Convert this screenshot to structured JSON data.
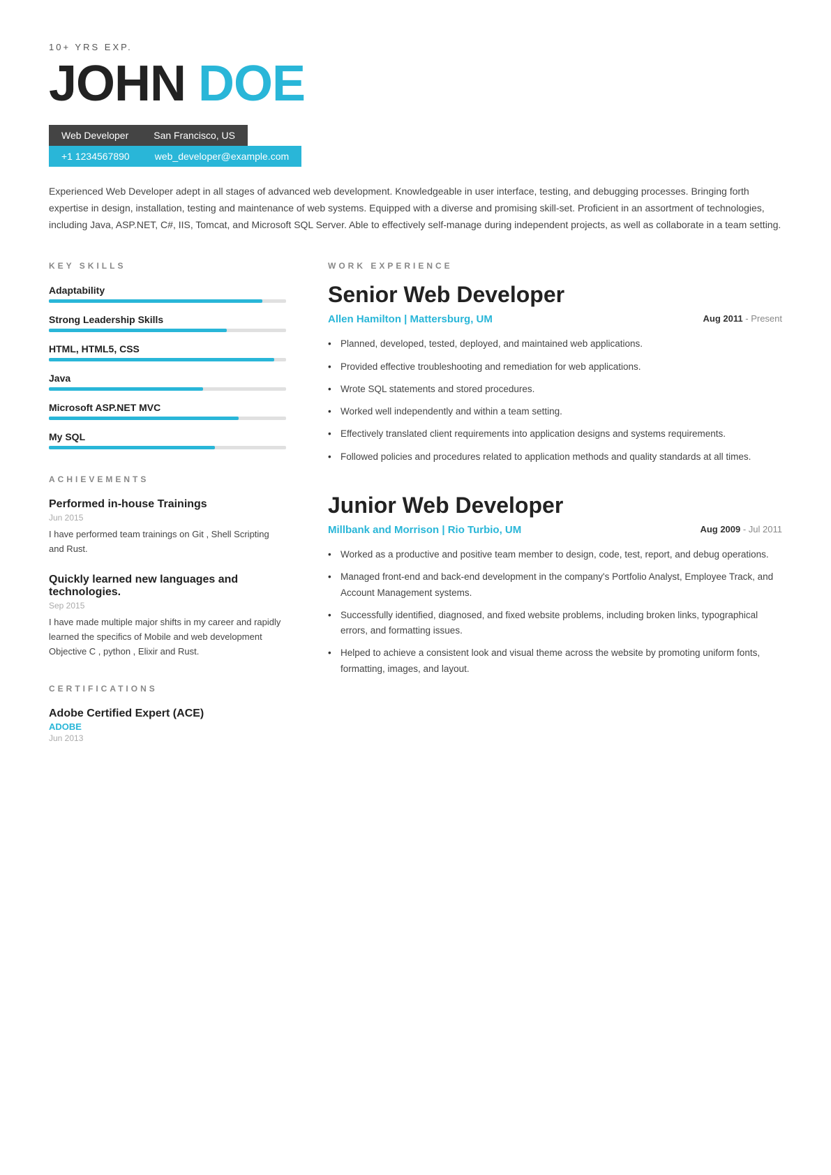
{
  "header": {
    "exp_label": "10+ YRS EXP.",
    "first_name": "JOHN",
    "last_name": "DOE",
    "title": "Web Developer",
    "location": "San Francisco, US",
    "phone": "+1 1234567890",
    "email": "web_developer@example.com"
  },
  "summary": "Experienced Web Developer adept in all stages of advanced web development. Knowledgeable in user interface, testing, and debugging processes. Bringing forth expertise in design, installation, testing and maintenance of web systems. Equipped with a diverse and promising skill-set. Proficient in an assortment of technologies, including Java, ASP.NET, C#, IIS, Tomcat, and Microsoft SQL Server. Able to effectively self-manage during independent projects, as well as collaborate in a team setting.",
  "sections": {
    "key_skills_label": "KEY SKILLS",
    "work_experience_label": "WORK EXPERIENCE",
    "achievements_label": "ACHIEVEMENTS",
    "certifications_label": "CERTIFICATIONS"
  },
  "skills": [
    {
      "name": "Adaptability",
      "pct": 90
    },
    {
      "name": "Strong Leadership Skills",
      "pct": 75
    },
    {
      "name": "HTML, HTML5, CSS",
      "pct": 95
    },
    {
      "name": "Java",
      "pct": 65
    },
    {
      "name": "Microsoft ASP.NET MVC",
      "pct": 80
    },
    {
      "name": "My SQL",
      "pct": 70
    }
  ],
  "achievements": [
    {
      "title": "Performed in-house Trainings",
      "date": "Jun 2015",
      "desc": "I have performed team trainings on Git , Shell Scripting and Rust."
    },
    {
      "title": "Quickly learned new languages and technologies.",
      "date": "Sep 2015",
      "desc": "I have made multiple major shifts in my career and rapidly learned the specifics of Mobile and web development Objective C , python , Elixir and Rust."
    }
  ],
  "certifications": [
    {
      "title": "Adobe Certified Expert (ACE)",
      "issuer": "ADOBE",
      "date": "Jun 2013"
    }
  ],
  "jobs": [
    {
      "title": "Senior Web Developer",
      "company": "Allen Hamilton | Mattersburg, UM",
      "date_start": "Aug 2011",
      "date_end": "Present",
      "bullets": [
        "Planned, developed, tested, deployed, and maintained web applications.",
        "Provided effective troubleshooting and remediation for web applications.",
        "Wrote SQL statements and stored procedures.",
        "Worked well independently and within a team setting.",
        "Effectively translated client requirements into application designs and systems requirements.",
        "Followed policies and procedures related to application methods and quality standards at all times."
      ]
    },
    {
      "title": "Junior Web Developer",
      "company": "Millbank and Morrison | Rio Turbio, UM",
      "date_start": "Aug 2009",
      "date_end": "Jul 2011",
      "bullets": [
        "Worked as a productive and positive team member to design, code, test, report, and debug operations.",
        "Managed front-end and back-end development in the company's Portfolio Analyst, Employee Track, and Account Management systems.",
        "Successfully identified, diagnosed, and fixed website problems, including broken links, typographical errors, and formatting issues.",
        "Helped to achieve a consistent look and visual theme across the website by promoting uniform fonts, formatting, images, and layout."
      ]
    }
  ]
}
